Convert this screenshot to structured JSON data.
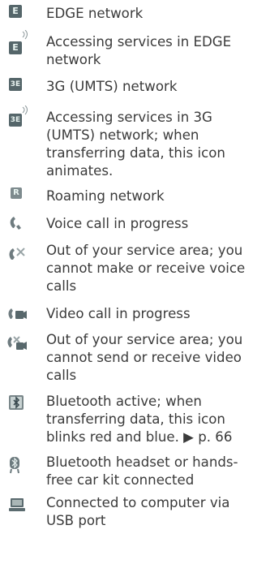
{
  "rows": [
    {
      "icon": "edge-network-icon",
      "lines": [
        "EDGE network"
      ]
    },
    {
      "icon": "edge-services-icon",
      "lines": [
        "Accessing services in EDGE",
        "network"
      ]
    },
    {
      "icon": "3g-network-icon",
      "lines": [
        "3G (UMTS) network"
      ]
    },
    {
      "icon": "3g-services-icon",
      "lines": [
        "Accessing services in 3G",
        "(UMTS) network; when",
        "transferring data, this icon",
        "animates."
      ]
    },
    {
      "icon": "roaming-icon",
      "lines": [
        "Roaming network"
      ]
    },
    {
      "icon": "voice-call-icon",
      "lines": [
        "Voice call in progress"
      ]
    },
    {
      "icon": "no-voice-service-icon",
      "lines": [
        "Out of your service area; you",
        "cannot make or receive voice",
        "calls"
      ]
    },
    {
      "icon": "video-call-icon",
      "lines": [
        "Video call in progress"
      ]
    },
    {
      "icon": "no-video-service-icon",
      "lines": [
        "Out of your service area; you",
        "cannot send or receive video",
        "calls"
      ]
    },
    {
      "icon": "bluetooth-active-icon",
      "lines": [
        "Bluetooth active; when",
        "transferring data, this icon",
        "blinks red and blue. ▶ p. 66"
      ]
    },
    {
      "icon": "bluetooth-headset-icon",
      "lines": [
        "Bluetooth headset or hands-",
        "free car kit connected"
      ]
    },
    {
      "icon": "usb-connected-icon",
      "lines": [
        "Connected to computer via",
        "USB port"
      ]
    }
  ]
}
